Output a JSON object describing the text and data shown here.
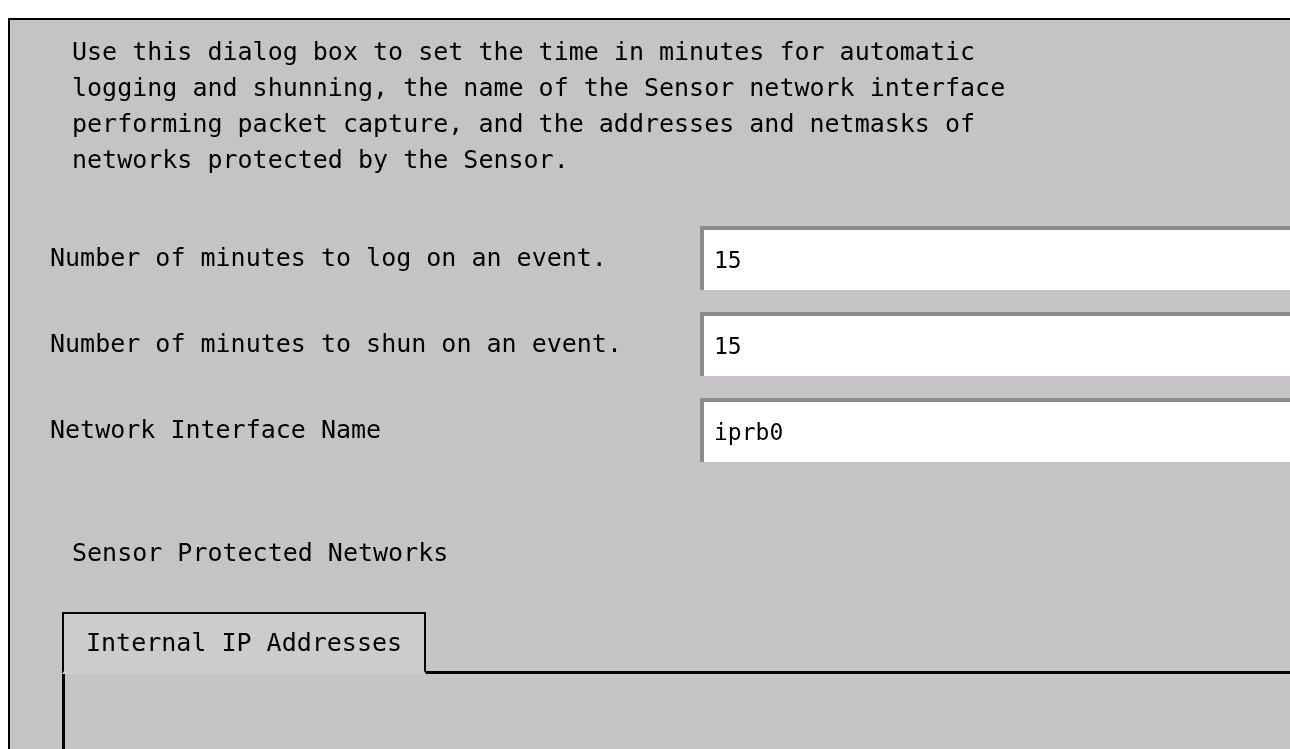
{
  "description": "Use this dialog box to set the time in minutes for automatic\nlogging and shunning, the name of the Sensor network interface\nperforming packet capture, and the addresses and netmasks of\nnetworks protected by the Sensor.",
  "fields": [
    {
      "label": "Number of minutes to log on an event.",
      "value": "15"
    },
    {
      "label": "Number of minutes to shun on an event.",
      "value": "15"
    },
    {
      "label": "Network Interface Name",
      "value": "iprb0"
    }
  ],
  "section_label": "Sensor Protected Networks",
  "tabs": [
    {
      "label": "Internal IP Addresses",
      "selected": true
    }
  ]
}
